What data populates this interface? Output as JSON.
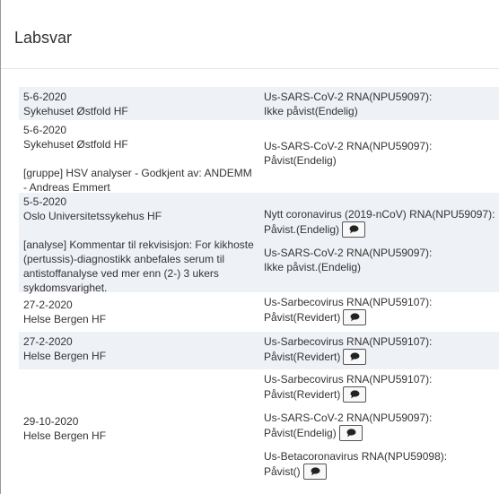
{
  "header": {
    "title": "Labsvar"
  },
  "rows": [
    {
      "date": "5-6-2020",
      "lab": "Sykehuset Østfold HF",
      "results": [
        {
          "test": "Us-SARS-CoV-2 RNA(NPU59097):",
          "value": "Ikke påvist(Endelig)"
        }
      ]
    },
    {
      "date": "5-6-2020",
      "lab": "Sykehuset Østfold HF",
      "comment1": "[gruppe] HSV analyser - Godkjent av: ANDEMM",
      "comment2": "- Andreas Emmert",
      "results": [
        {
          "test": "Us-SARS-CoV-2 RNA(NPU59097):",
          "value": "Påvist(Endelig)"
        }
      ]
    },
    {
      "date": "5-5-2020",
      "lab": "Oslo Universitetssykehus HF",
      "comment1": "[analyse] Kommentar til rekvisisjon: For kikhoste",
      "comment2": "(pertussis)-diagnostikk anbefales serum til",
      "comment3": "antistoffanalyse ved mer enn (2-) 3 ukers",
      "comment4": "sykdomsvarighet.",
      "results": [
        {
          "test": "Nytt coronavirus (2019-nCoV) RNA(NPU59097):",
          "value": "Påvist.(Endelig)"
        },
        {
          "test": "Us-SARS-CoV-2 RNA(NPU59097):",
          "value": "Ikke påvist.(Endelig)"
        }
      ]
    },
    {
      "date": "27-2-2020",
      "lab": "Helse Bergen HF",
      "results": [
        {
          "test": "Us-Sarbecovirus RNA(NPU59107):",
          "value": "Påvist(Revidert)"
        }
      ]
    },
    {
      "date": "27-2-2020",
      "lab": "Helse Bergen HF",
      "results": [
        {
          "test": "Us-Sarbecovirus RNA(NPU59107):",
          "value": "Påvist(Revidert)"
        }
      ]
    },
    {
      "date": "29-10-2020",
      "lab": "Helse Bergen HF",
      "results": [
        {
          "test": "Us-Sarbecovirus RNA(NPU59107):",
          "value": "Påvist(Revidert)"
        },
        {
          "test": "Us-SARS-CoV-2 RNA(NPU59097):",
          "value": "Påvist(Endelig)"
        },
        {
          "test": "Us-Betacoronavirus RNA(NPU59098):",
          "value": "Påvist()"
        }
      ]
    }
  ],
  "icons": {
    "comment": "comment-icon"
  }
}
